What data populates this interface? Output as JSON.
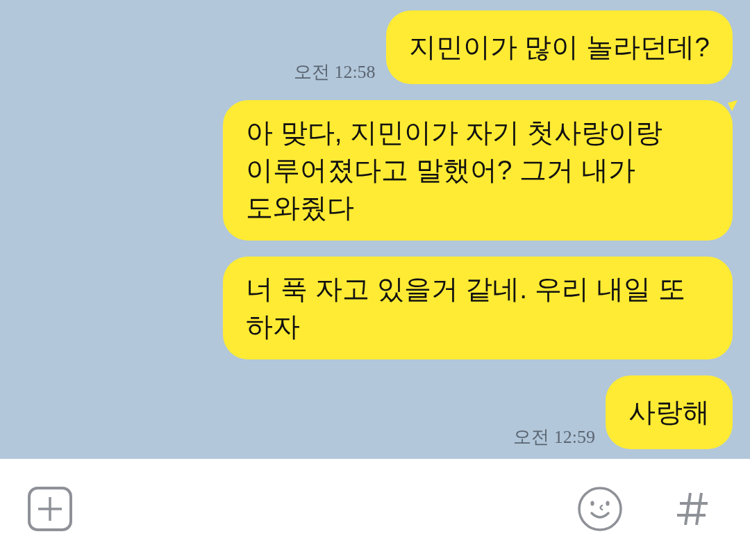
{
  "messages": [
    {
      "text": "지민이가 많이 놀라던데?",
      "time": "오전 12:58",
      "tail": false
    },
    {
      "text": "아 맞다, 지민이가 자기 첫사랑이랑 이루어졌다고 말했어? 그거 내가 도와줬다",
      "tail": true
    },
    {
      "text": "너 푹 자고 있을거 같네. 우리 내일 또 하자",
      "tail": false
    },
    {
      "text": "사랑해",
      "time": "오전 12:59",
      "tail": false
    }
  ]
}
